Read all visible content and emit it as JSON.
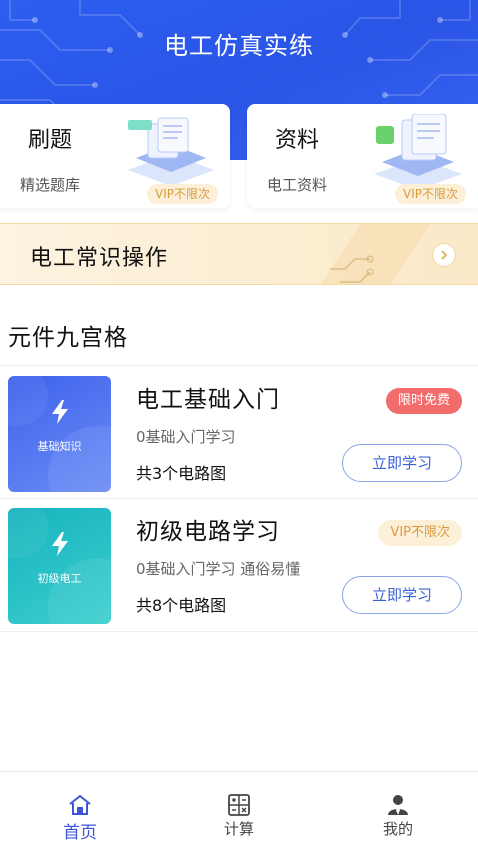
{
  "header": {
    "title": "电工仿真实练"
  },
  "cards": [
    {
      "title": "刷题",
      "subtitle": "精选题库",
      "badge": "VIP不限次",
      "icon": "question-bank-icon"
    },
    {
      "title": "资料",
      "subtitle": "电工资料",
      "badge": "VIP不限次",
      "icon": "documents-icon"
    }
  ],
  "banner": {
    "text": "电工常识操作",
    "icon": "chevron-right-icon"
  },
  "section": {
    "title": "元件九宫格"
  },
  "courses": [
    {
      "thumb_label": "基础知识",
      "name": "电工基础入门",
      "badge": "限时免费",
      "desc": "0基础入门学习",
      "count": "共3个电路图",
      "action": "立即学习",
      "thumb_color": "#4a6ff0"
    },
    {
      "thumb_label": "初级电工",
      "name": "初级电路学习",
      "badge": "VIP不限次",
      "desc": "0基础入门学习 通俗易懂",
      "count": "共8个电路图",
      "action": "立即学习",
      "thumb_color": "#1fb6c2"
    }
  ],
  "tabbar": [
    {
      "label": "首页",
      "icon": "home-icon",
      "active": true
    },
    {
      "label": "计算",
      "icon": "calculator-icon",
      "active": false
    },
    {
      "label": "我的",
      "icon": "user-icon",
      "active": false
    }
  ],
  "colors": {
    "primary": "#2c5ef0",
    "accent_text": "#3a55d8",
    "vip_bg": "#fdf0d9",
    "vip_text": "#d99a3e",
    "free_badge": "#f36c6c"
  }
}
